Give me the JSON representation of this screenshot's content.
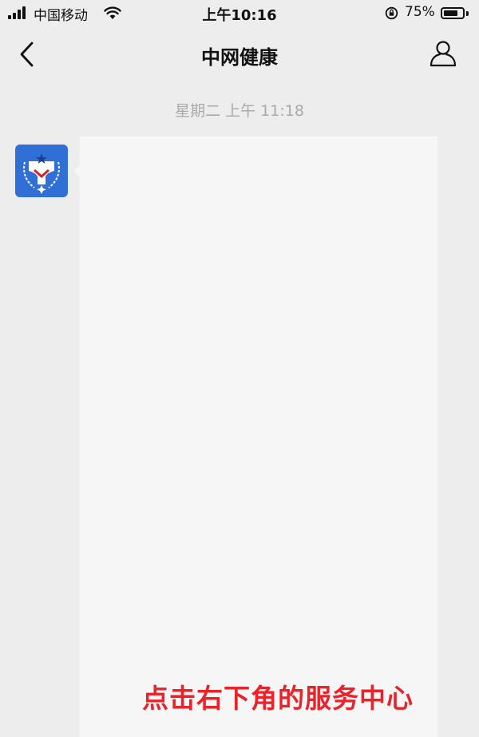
{
  "status_bar": {
    "carrier": "中国移动",
    "time": "上午10:16",
    "battery_percent": "75%",
    "battery_level": 0.75,
    "icons": [
      "signal-icon",
      "wifi-icon",
      "orientation-lock-icon",
      "battery-icon"
    ]
  },
  "nav": {
    "title": "中网健康",
    "back_icon": "chevron-left-icon",
    "profile_icon": "person-icon"
  },
  "chat": {
    "timestamp": "星期二 上午 11:18",
    "sender_avatar_icon": "health-logo-icon",
    "caption": "点击右下角的服务中心"
  },
  "colors": {
    "background": "#ededed",
    "bubble": "#f6f6f6",
    "caption": "#e8232a",
    "avatar_blue": "#2f6fd6"
  }
}
